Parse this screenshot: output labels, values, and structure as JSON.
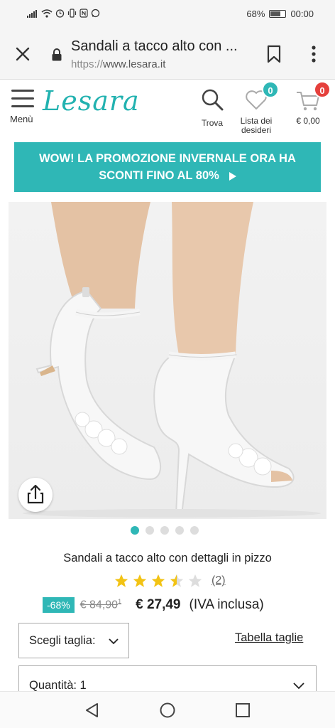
{
  "statusbar": {
    "battery": "68%",
    "time": "00:00"
  },
  "browser": {
    "tab_title": "Sandali a tacco alto con ...",
    "url_protocol": "https://",
    "url_host": "www.lesara.it"
  },
  "header": {
    "logo": "Lesara",
    "menu_label": "Menù",
    "search_label": "Trova",
    "wishlist_label_line1": "Lista dei",
    "wishlist_label_line2": "desideri",
    "wishlist_count": "0",
    "cart_total": "€ 0,00",
    "cart_count": "0"
  },
  "promo": {
    "line1": "WOW! LA PROMOZIONE INVERNALE ORA HA",
    "line2": "SCONTI FINO AL 80%"
  },
  "gallery": {
    "image_count": 5,
    "active_index": 0
  },
  "product": {
    "title": "Sandali a tacco alto con dettagli in pizzo",
    "rating": 3.5,
    "rating_max": 5,
    "review_count": "(2)",
    "discount": "-68%",
    "old_price": "€ 84,90",
    "old_price_note": "1",
    "price": "€ 27,49",
    "vat_note": "(IVA inclusa)",
    "size_select_label": "Scegli taglia:",
    "size_table_link": "Tabella taglie",
    "quantity_label": "Quantità: 1"
  },
  "colors": {
    "brand": "#2fb7b6",
    "badge_wishlist": "#2fb7b6",
    "badge_cart": "#e5403c",
    "star": "#f2c314"
  }
}
